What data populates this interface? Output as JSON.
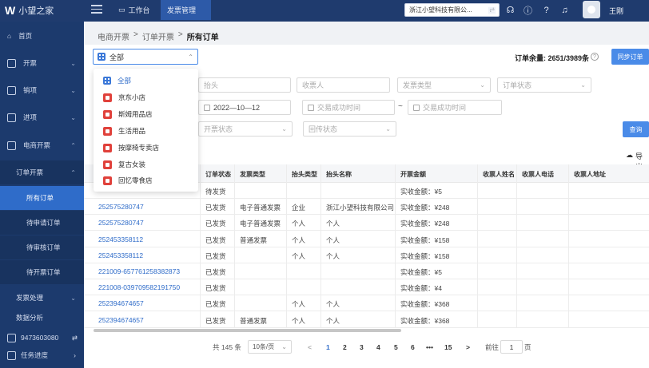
{
  "header": {
    "logo_mark": "W",
    "logo_text": "小望之家",
    "tabs": [
      {
        "label": "工作台"
      },
      {
        "label": "发票管理"
      }
    ],
    "company": "浙江小望科技有限公...",
    "user": "王刚"
  },
  "sidebar": {
    "items": [
      {
        "label": "首页"
      },
      {
        "label": "开票"
      },
      {
        "label": "销项"
      },
      {
        "label": "进项"
      },
      {
        "label": "电商开票"
      },
      {
        "label": "订单开票"
      },
      {
        "label": "所有订单"
      },
      {
        "label": "待申请订单"
      },
      {
        "label": "待审核订单"
      },
      {
        "label": "待开票订单"
      },
      {
        "label": "发票处理"
      },
      {
        "label": "数据分析"
      }
    ],
    "footer_number": "9473603080",
    "footer_progress": "任务进度"
  },
  "breadcrumb": [
    "电商开票",
    "订单开票",
    "所有订单"
  ],
  "shop_select": {
    "value": "全部"
  },
  "balance": {
    "label": "订单余量:",
    "value": "2651/3989条"
  },
  "sync_button": "同步订单",
  "filters": {
    "title_placeholder": "抬头",
    "receiver_placeholder": "收票人",
    "invoice_type_placeholder": "发票类型",
    "order_status_placeholder": "订单状态",
    "start_date": "2022—10—12",
    "trade_start_placeholder": "交易成功时间",
    "trade_end_placeholder": "交易成功时间",
    "invoice_status_placeholder": "开票状态",
    "return_status_placeholder": "回传状态"
  },
  "query_button": "查询",
  "export_label": "导出",
  "dropdown": {
    "items": [
      {
        "label": "全部",
        "selected": true
      },
      {
        "label": "京东小店"
      },
      {
        "label": "斯姆用品店"
      },
      {
        "label": "生活用品"
      },
      {
        "label": "按摩椅专卖店"
      },
      {
        "label": "复古女装"
      },
      {
        "label": "回忆零食店"
      }
    ]
  },
  "table": {
    "columns": [
      "订单状态",
      "发票类型",
      "抬头类型",
      "抬头名称",
      "开票金额",
      "收票人姓名",
      "收票人电话",
      "收票人地址"
    ],
    "rows": [
      {
        "order": "",
        "status": "待发货",
        "invoice_type": "",
        "title_type": "",
        "title_name": "",
        "amount": "实收金额：¥5"
      },
      {
        "order": "252575280747",
        "status": "已发货",
        "invoice_type": "电子普通发票",
        "title_type": "企业",
        "title_name": "浙江小望科技有限公司",
        "amount": "实收金额：¥248"
      },
      {
        "order": "252575280747",
        "status": "已发货",
        "invoice_type": "电子普通发票",
        "title_type": "个人",
        "title_name": "个人",
        "amount": "实收金额：¥248"
      },
      {
        "order": "252453358112",
        "status": "已发货",
        "invoice_type": "普通发票",
        "title_type": "个人",
        "title_name": "个人",
        "amount": "实收金额：¥158"
      },
      {
        "order": "252453358112",
        "status": "已发货",
        "invoice_type": "",
        "title_type": "个人",
        "title_name": "个人",
        "amount": "实收金额：¥158"
      },
      {
        "order": "221009-657761258382873",
        "status": "已发货",
        "invoice_type": "",
        "title_type": "",
        "title_name": "",
        "amount": "实收金额：¥5"
      },
      {
        "order": "221008-039709582191750",
        "status": "已发货",
        "invoice_type": "",
        "title_type": "",
        "title_name": "",
        "amount": "实收金额：¥4"
      },
      {
        "order": "252394674657",
        "status": "已发货",
        "invoice_type": "",
        "title_type": "个人",
        "title_name": "个人",
        "amount": "实收金额：¥368"
      },
      {
        "order": "252394674657",
        "status": "已发货",
        "invoice_type": "普通发票",
        "title_type": "个人",
        "title_name": "个人",
        "amount": "实收金额：¥368"
      }
    ]
  },
  "pagination": {
    "total": "共 145 条",
    "page_size": "10条/页",
    "pages": [
      "1",
      "2",
      "3",
      "4",
      "5",
      "6",
      "•••",
      "15"
    ],
    "current": "1",
    "prev": "<",
    "next": ">",
    "goto_label": "前往",
    "goto_value": "1",
    "page_suffix": "页"
  }
}
